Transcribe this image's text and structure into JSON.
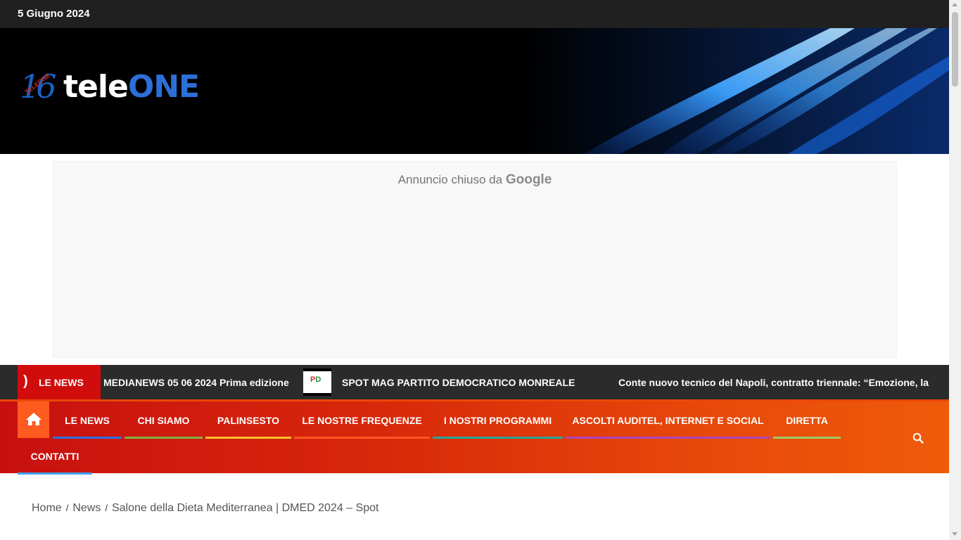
{
  "topbar": {
    "date": "5 Giugno 2024"
  },
  "logo": {
    "number": "16",
    "badge": "TELEONE",
    "tele": "tele",
    "one": "ONE"
  },
  "ad": {
    "closed_text": "Annuncio chiuso da",
    "closed_brand": "Google"
  },
  "ticker": {
    "label": "LE NEWS",
    "items": [
      "MEDIANEWS 05 06 2024 Prima edizione",
      "SPOT MAG PARTITO DEMOCRATICO MONREALE",
      "Conte nuovo tecnico del Napoli, contratto triennale: “Emozione, la panc"
    ],
    "thumb_text_a": "P",
    "thumb_text_b": "D"
  },
  "nav": {
    "items": [
      {
        "label": "LE NEWS",
        "color": "#2f6fe0"
      },
      {
        "label": "CHI SIAMO",
        "color": "#7cb342"
      },
      {
        "label": "PALINSESTO",
        "color": "#fbc02d"
      },
      {
        "label": "LE NOSTRE FREQUENZE",
        "color": "#ff5722"
      },
      {
        "label": "I NOSTRI PROGRAMMI",
        "color": "#26a69a"
      },
      {
        "label": "ASCOLTI AUDITEL, INTERNET E SOCIAL",
        "color": "#ab47bc"
      },
      {
        "label": "DIRETTA",
        "color": "#9ccc65"
      },
      {
        "label": "CONTATTI",
        "color": "#42a5f5"
      }
    ],
    "accent_color": "#ff5a1f"
  },
  "breadcrumb": {
    "home": "Home",
    "news": "News",
    "current": "Salone della Dieta Mediterranea | DMED 2024 – Spot"
  }
}
